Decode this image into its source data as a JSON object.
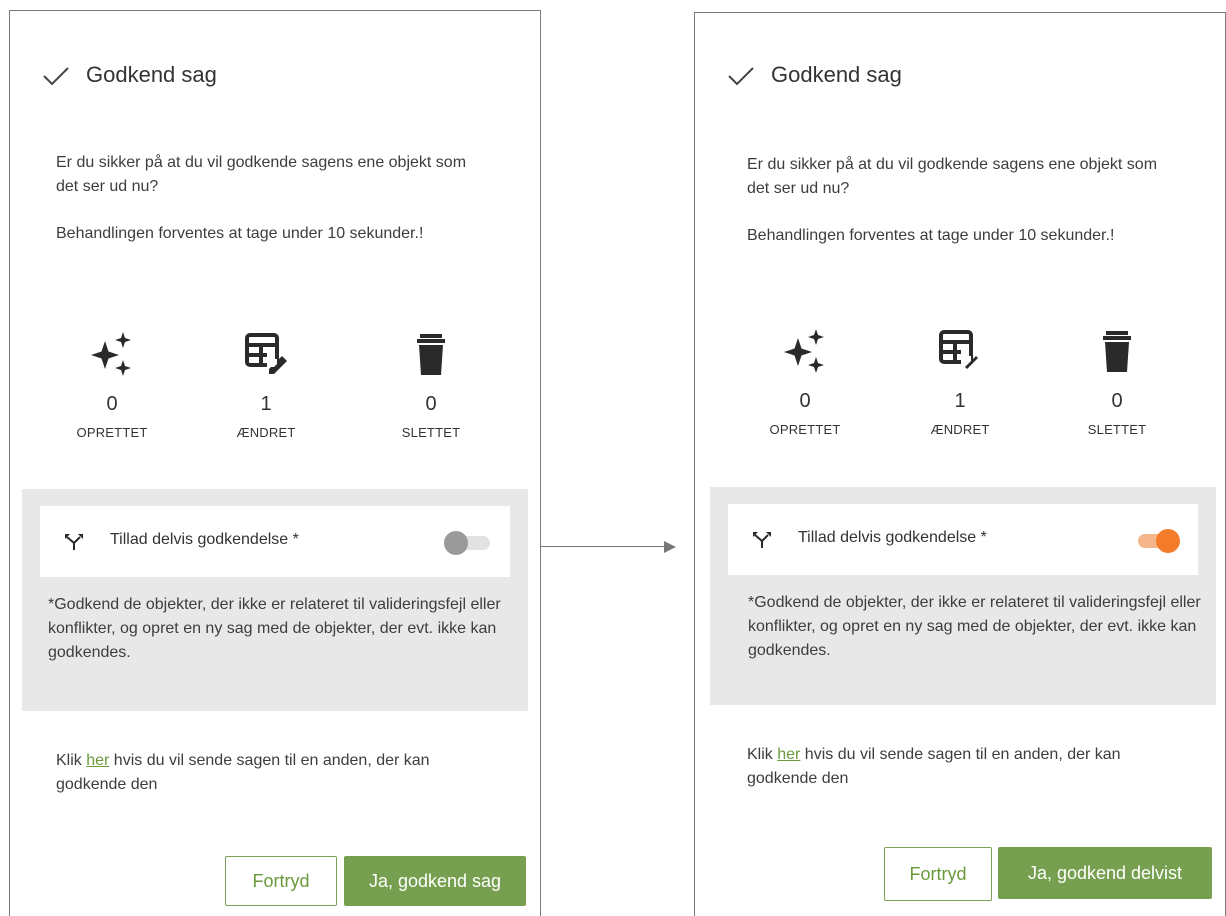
{
  "left": {
    "title": "Godkend sag",
    "question": "Er du sikker på at du vil godkende sagens ene objekt som det ser ud nu?",
    "duration": "Behandlingen forventes at tage under 10 sekunder.!",
    "stats": [
      {
        "value": "0",
        "label": "OPRETTET",
        "icon": "sparkles-icon"
      },
      {
        "value": "1",
        "label": "ÆNDRET",
        "icon": "table-edit-icon"
      },
      {
        "value": "0",
        "label": "SLETTET",
        "icon": "trash-icon"
      }
    ],
    "toggle": {
      "label": "Tillad delvis godkendelse *",
      "state": "off",
      "icon": "split-arrows-icon"
    },
    "note": "*Godkend de objekter, der ikke er relateret til valideringsfejl eller konflikter, og opret en ny sag med de objekter, der evt. ikke kan godkendes.",
    "klik_prefix": "Klik ",
    "klik_link": "her",
    "klik_suffix": " hvis du vil sende sagen til en anden, der kan godkende den",
    "cancel_label": "Fortryd",
    "confirm_label": "Ja, godkend sag"
  },
  "right": {
    "title": "Godkend sag",
    "question": "Er du sikker på at du vil godkende sagens ene objekt som det ser ud nu?",
    "duration": "Behandlingen forventes at tage under 10 sekunder.!",
    "stats": [
      {
        "value": "0",
        "label": "OPRETTET",
        "icon": "sparkles-icon"
      },
      {
        "value": "1",
        "label": "ÆNDRET",
        "icon": "table-edit-icon"
      },
      {
        "value": "0",
        "label": "SLETTET",
        "icon": "trash-icon"
      }
    ],
    "toggle": {
      "label": "Tillad delvis godkendelse *",
      "state": "on",
      "icon": "split-arrows-icon"
    },
    "note": "*Godkend de objekter, der ikke er relateret til valideringsfejl eller konflikter, og opret en ny sag med de objekter, der evt. ikke kan godkendes.",
    "klik_prefix": "Klik ",
    "klik_link": "her",
    "klik_suffix": " hvis du vil sende sagen til en anden, der kan godkende den",
    "cancel_label": "Fortryd",
    "confirm_label": "Ja, godkend delvist"
  },
  "colors": {
    "accent_green": "#76a050",
    "toggle_on": "#f47b29",
    "toggle_off": "#9a9a9a",
    "gray_box": "#e8e8e8"
  }
}
